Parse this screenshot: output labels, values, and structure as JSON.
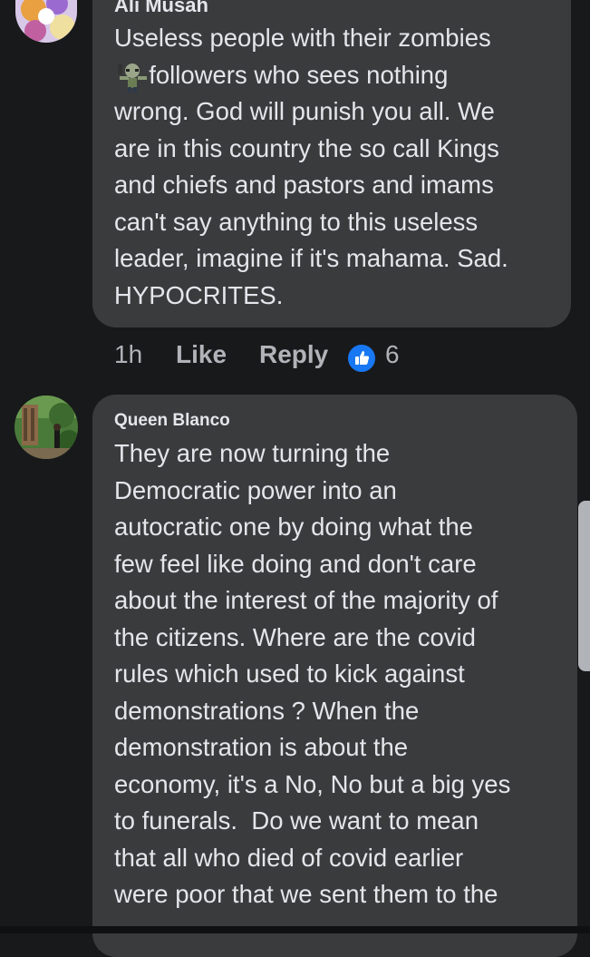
{
  "comments": [
    {
      "author": "Ali Musah",
      "text": "Useless people with their zombies\n     followers who sees nothing\nwrong. God will punish you all. We\nare in this country the so call Kings\nand chiefs and pastors and imams\ncan't say anything to this useless\nleader, imagine if it's mahama. Sad.\nHYPOCRITES.",
      "emoji": "zombie-emoji",
      "time": "1h",
      "like_label": "Like",
      "reply_label": "Reply",
      "reaction_count": "6",
      "reaction_icon": "thumbs-up-icon",
      "reaction_color": "#1877f2"
    },
    {
      "author": "Queen Blanco",
      "text": "They are now turning the\nDemocratic power into an\nautocratic one by doing what the\nfew feel like doing and don't care\nabout the interest of the majority of\nthe citizens. Where are the covid\nrules which used to kick against\ndemonstrations ? When the\ndemonstration is about the\neconomy, it's a No, No but a big yes\nto funerals.  Do we want to mean\nthat all who died of covid earlier\nwere poor that we sent them to the"
    }
  ],
  "theme": {
    "background": "#18191a",
    "bubble": "#3a3b3c",
    "text": "#e4e6eb",
    "secondary_text": "#b0b3b8"
  }
}
